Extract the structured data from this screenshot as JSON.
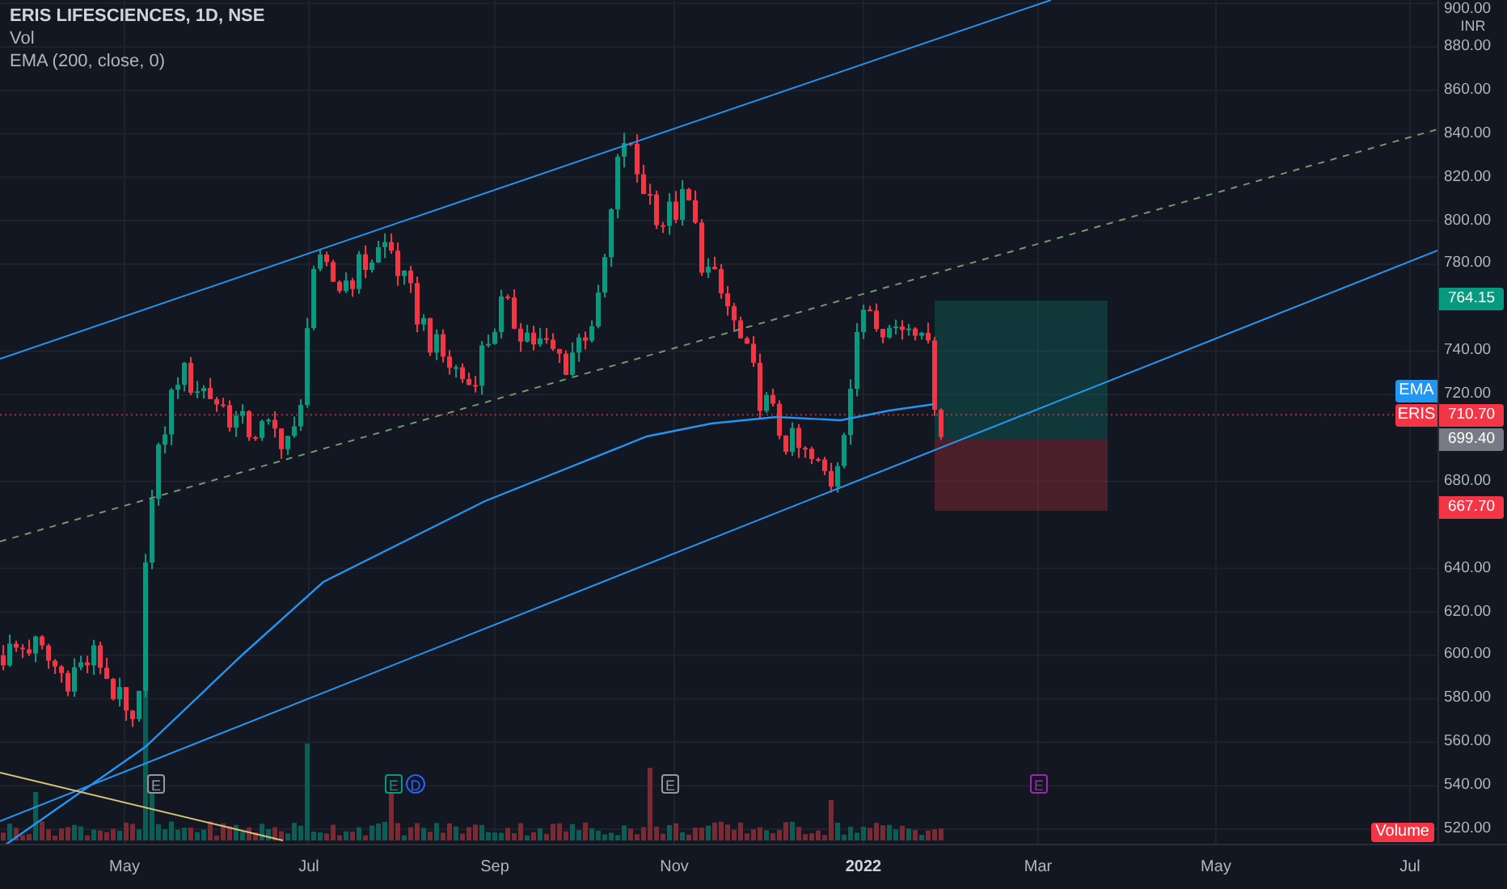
{
  "legend": {
    "title": "ERIS LIFESCIENCES, 1D, NSE",
    "lines": [
      "Vol",
      "EMA (200, close, 0)"
    ]
  },
  "price_axis": {
    "currency": "INR",
    "ticks": [
      "900.00",
      "880.00",
      "860.00",
      "840.00",
      "820.00",
      "800.00",
      "780.00",
      "740.00",
      "720.00",
      "680.00",
      "640.00",
      "620.00",
      "600.00",
      "580.00",
      "560.00",
      "540.00",
      "520.00"
    ]
  },
  "price_tags": [
    {
      "kind": "price",
      "value": "764.15",
      "color": "#089981"
    },
    {
      "kind": "indicator",
      "label": "EMA",
      "color": "#2196f3"
    },
    {
      "kind": "symbol",
      "label": "ERIS",
      "value": "710.70",
      "color": "#f23645"
    },
    {
      "kind": "price",
      "value": "699.40",
      "color": "#787b86"
    },
    {
      "kind": "price",
      "value": "667.70",
      "color": "#f23645"
    }
  ],
  "volume_badge": "Volume",
  "time_axis": [
    {
      "label": "May",
      "bold": false
    },
    {
      "label": "Jul",
      "bold": false
    },
    {
      "label": "Sep",
      "bold": false
    },
    {
      "label": "Nov",
      "bold": false
    },
    {
      "label": "2022",
      "bold": true
    },
    {
      "label": "Mar",
      "bold": false
    },
    {
      "label": "May",
      "bold": false
    },
    {
      "label": "Jul",
      "bold": false
    }
  ],
  "events": [
    {
      "kind": "earnings",
      "label": "E",
      "color": "#9598a1"
    },
    {
      "kind": "earnings",
      "label": "E",
      "color": "#089981"
    },
    {
      "kind": "dividend",
      "label": "D",
      "color": "#2962ff"
    },
    {
      "kind": "earnings",
      "label": "E",
      "color": "#9598a1"
    },
    {
      "kind": "earnings",
      "label": "E",
      "color": "#9c27b0"
    }
  ]
}
